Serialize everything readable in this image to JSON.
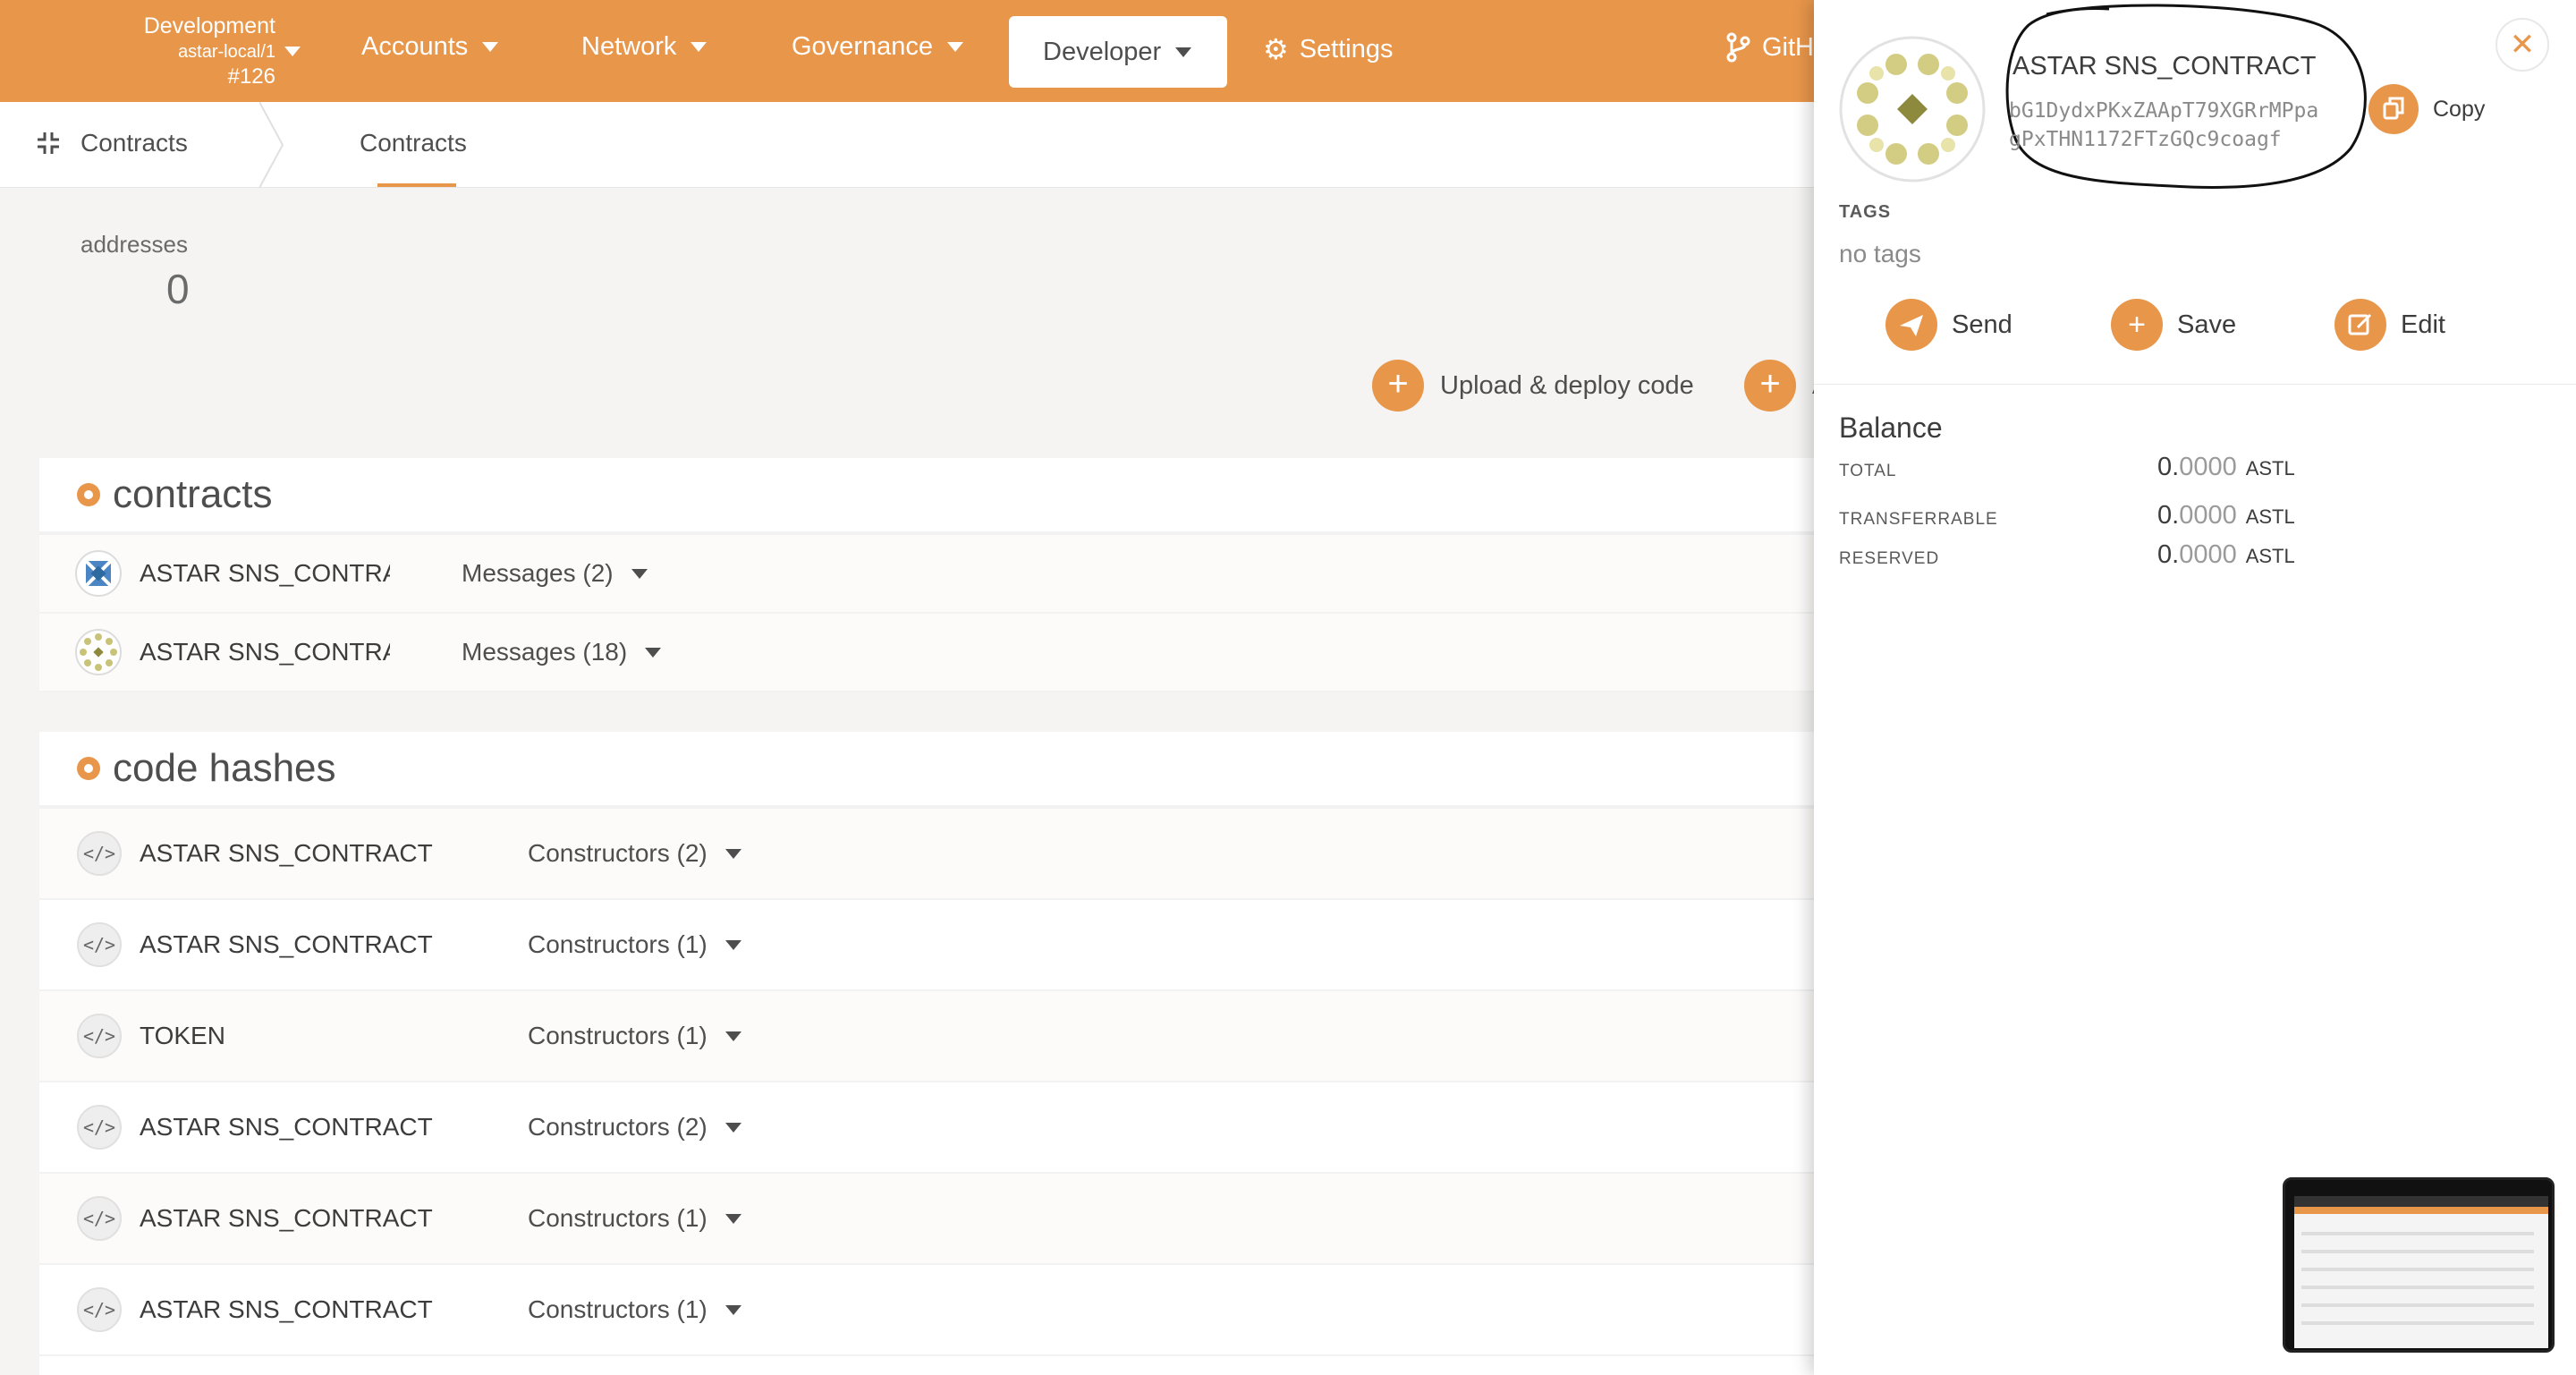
{
  "topnav": {
    "chain_line1": "Development",
    "chain_line2": "astar-local/1",
    "chain_line3": "#126",
    "items": [
      {
        "label": "Accounts"
      },
      {
        "label": "Network"
      },
      {
        "label": "Governance"
      },
      {
        "label": "Developer"
      },
      {
        "label": "Settings"
      },
      {
        "label": "GitH"
      }
    ],
    "accent_color": "#e8964a"
  },
  "tabbar": {
    "section_label": "Contracts",
    "active_tab": "Contracts"
  },
  "summary": {
    "addresses_label": "addresses",
    "addresses_value": "0"
  },
  "actions": {
    "upload_label": "Upload & deploy code",
    "second_label": "A"
  },
  "contracts": {
    "title": "contracts",
    "rows": [
      {
        "name": "ASTAR SNS_CONTRA",
        "messages": "Messages (2)"
      },
      {
        "name": "ASTAR SNS_CONTRA",
        "messages": "Messages (18)"
      }
    ]
  },
  "code_hashes": {
    "title": "code hashes",
    "rows": [
      {
        "name": "ASTAR SNS_CONTRACT",
        "constructors": "Constructors (2)"
      },
      {
        "name": "ASTAR SNS_CONTRACT",
        "constructors": "Constructors (1)"
      },
      {
        "name": "TOKEN",
        "constructors": "Constructors (1)"
      },
      {
        "name": "ASTAR SNS_CONTRACT",
        "constructors": "Constructors (2)"
      },
      {
        "name": "ASTAR SNS_CONTRACT",
        "constructors": "Constructors (1)"
      },
      {
        "name": "ASTAR SNS_CONTRACT",
        "constructors": "Constructors (1)"
      }
    ]
  },
  "panel": {
    "account_name": "ASTAR SNS_CONTRACT",
    "address": "bG1DydxPKxZAApT79XGRrMPpagPxTHN1172FTzGQc9coagf",
    "copy_label": "Copy",
    "tags_label": "TAGS",
    "tags_value": "no tags",
    "buttons": {
      "send": "Send",
      "save": "Save",
      "edit": "Edit"
    },
    "balance_title": "Balance",
    "balances": [
      {
        "label": "TOTAL",
        "int": "0.",
        "dec": "0000",
        "unit": "ASTL"
      },
      {
        "label": "TRANSFERRABLE",
        "int": "0.",
        "dec": "0000",
        "unit": "ASTL"
      },
      {
        "label": "RESERVED",
        "int": "0.",
        "dec": "0000",
        "unit": "ASTL"
      }
    ]
  }
}
